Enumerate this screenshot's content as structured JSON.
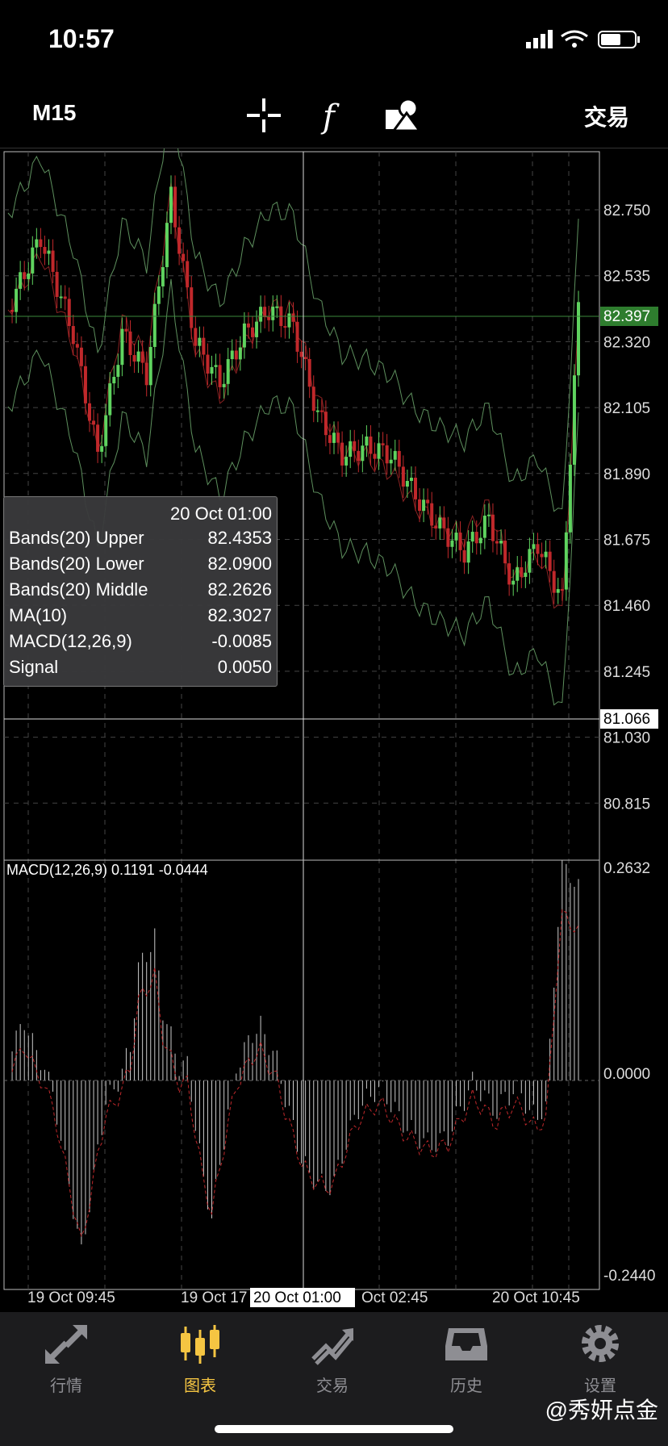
{
  "status": {
    "time": "10:57"
  },
  "toolbar": {
    "timeframe": "M15",
    "trade_label": "交易"
  },
  "price_axis": [
    "82.750",
    "82.535",
    "82.320",
    "82.105",
    "81.890",
    "81.675",
    "81.460",
    "81.245",
    "81.030",
    "80.815"
  ],
  "current_price": "82.397",
  "crosshair_price": "81.066",
  "tooltip": {
    "date": "20 Oct 01:00",
    "rows": [
      {
        "label": "Bands(20) Upper",
        "value": "82.4353"
      },
      {
        "label": "Bands(20) Lower",
        "value": "82.0900"
      },
      {
        "label": "Bands(20) Middle",
        "value": "82.2626"
      },
      {
        "label": "MA(10)",
        "value": "82.3027"
      },
      {
        "label": "MACD(12,26,9)",
        "value": "-0.0085"
      },
      {
        "label": "Signal",
        "value": "0.0050"
      }
    ]
  },
  "macd": {
    "title": "MACD(12,26,9) 0.1191 -0.0444",
    "axis": [
      "0.2632",
      "0.0000",
      "-0.2440"
    ]
  },
  "time_axis": [
    "19 Oct 09:45",
    "19 Oct 17",
    "Oct 02:45",
    "20 Oct 10:45"
  ],
  "time_cursor": "20 Oct 01:00",
  "tabs": [
    {
      "label": "行情",
      "icon": "arrows-icon",
      "active": false
    },
    {
      "label": "图表",
      "icon": "candles-icon",
      "active": true
    },
    {
      "label": "交易",
      "icon": "trend-icon",
      "active": false
    },
    {
      "label": "历史",
      "icon": "inbox-icon",
      "active": false
    },
    {
      "label": "设置",
      "icon": "gear-icon",
      "active": false
    }
  ],
  "watermark": "@秀妍点金",
  "colors": {
    "bull": "#5fd35f",
    "bear": "#c0282b",
    "active_tab": "#f5c542",
    "bands": "#5d8f5d"
  }
}
